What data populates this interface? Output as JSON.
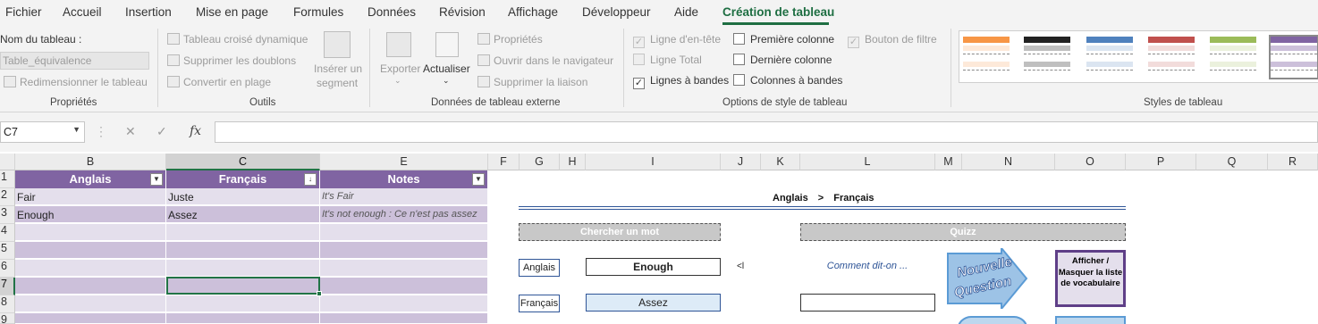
{
  "menu": {
    "tabs": [
      "Fichier",
      "Accueil",
      "Insertion",
      "Mise en page",
      "Formules",
      "Données",
      "Révision",
      "Affichage",
      "Développeur",
      "Aide",
      "Création de tableau"
    ],
    "active_tab": "Création de tableau"
  },
  "ribbon": {
    "proprietes": {
      "table_name_label": "Nom du tableau :",
      "table_name_value": "Table_équivalence",
      "resize_label": "Redimensionner le tableau",
      "group_label": "Propriétés"
    },
    "outils": {
      "pivot": "Tableau croisé dynamique",
      "remove_duplicates": "Supprimer les doublons",
      "convert_range": "Convertir en plage",
      "insert_slicer_line1": "Insérer un",
      "insert_slicer_line2": "segment",
      "group_label": "Outils"
    },
    "donnees_externes": {
      "export": "Exporter",
      "refresh": "Actualiser",
      "properties": "Propriétés",
      "open_browser": "Ouvrir dans le navigateur",
      "unlink": "Supprimer la liaison",
      "group_label": "Données de tableau externe"
    },
    "options_style": {
      "header_row": "Ligne d'en-tête",
      "total_row": "Ligne Total",
      "banded_rows": "Lignes à bandes",
      "first_column": "Première colonne",
      "last_column": "Dernière colonne",
      "banded_columns": "Colonnes à bandes",
      "filter_button": "Bouton de filtre",
      "group_label": "Options de style de tableau"
    },
    "styles": {
      "group_label": "Styles de tableau",
      "swatch_colors": [
        "#f79646",
        "#222222",
        "#4f81bd",
        "#c0504d",
        "#9bbb59",
        "#8064a2"
      ]
    }
  },
  "formula_bar": {
    "name_box": "C7",
    "cancel_icon": "✕",
    "enter_icon": "✓",
    "fx_label": "fx",
    "formula_value": ""
  },
  "grid": {
    "columns": [
      "B",
      "C",
      "E",
      "F",
      "G",
      "H",
      "I",
      "J",
      "K",
      "L",
      "M",
      "N",
      "O",
      "P",
      "Q",
      "R"
    ],
    "rows": [
      "1",
      "2",
      "3",
      "4",
      "5",
      "6",
      "7",
      "8",
      "9"
    ],
    "table": {
      "headers": [
        "Anglais",
        "Français",
        "Notes"
      ],
      "rows": [
        [
          "Fair",
          "Juste",
          "It's Fair"
        ],
        [
          "Enough",
          "Assez",
          "It's not enough : Ce n'est pas assez"
        ]
      ],
      "colors": {
        "header": "#8064a2",
        "band_dark": "#ccc0da",
        "band_light": "#e4dfec"
      }
    }
  },
  "dashboard": {
    "title_from": "Anglais",
    "title_sep": ">",
    "title_to": "Français",
    "search_header": "Chercher un mot",
    "quiz_header": "Quizz",
    "label_english": "Anglais",
    "label_french": "Français",
    "english_word": "Enough",
    "french_word": "Assez",
    "arrow_marker": "<l",
    "quiz_prompt": "Comment dit-on ...",
    "quiz_answer": "",
    "new_question_line1": "Nouvelle",
    "new_question_line2": "Question",
    "toggle_list_button": "Afficher / Masquer la liste de vocabulaire"
  }
}
